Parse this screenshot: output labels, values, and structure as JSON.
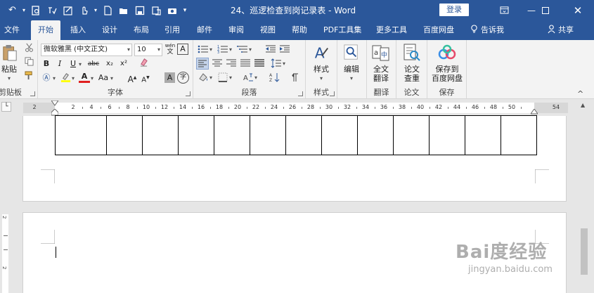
{
  "titlebar": {
    "doc_title": "24、巡逻检查到岗记录表 - Word",
    "login_label": "登录",
    "icons": [
      "undo-icon",
      "redo-icon",
      "print-preview-icon",
      "spelling-icon",
      "markup-icon",
      "touch-mode-icon",
      "new-doc-icon",
      "open-icon",
      "save-icon",
      "save-as-icon",
      "camera-icon",
      "customize-icon"
    ]
  },
  "tabs": [
    {
      "label": "文件"
    },
    {
      "label": "开始"
    },
    {
      "label": "插入"
    },
    {
      "label": "设计"
    },
    {
      "label": "布局"
    },
    {
      "label": "引用"
    },
    {
      "label": "邮件"
    },
    {
      "label": "审阅"
    },
    {
      "label": "视图"
    },
    {
      "label": "帮助"
    },
    {
      "label": "PDF工具集"
    },
    {
      "label": "更多工具"
    },
    {
      "label": "百度网盘"
    },
    {
      "label": "告诉我"
    },
    {
      "label": "共享"
    }
  ],
  "ribbon": {
    "clipboard": {
      "paste_label": "粘贴",
      "group_label": "剪贴板"
    },
    "font": {
      "font_name": "微软雅黑 (中文正文)",
      "font_size": "10",
      "wen_label": "wén",
      "a_box_label": "A",
      "bold": "B",
      "italic": "I",
      "underline": "U",
      "strike": "abc",
      "subscript": "x₂",
      "superscript": "x²",
      "grow": "A",
      "shrink": "A",
      "case": "Aa",
      "char_shade": "A",
      "enclose": "字",
      "group_label": "字体"
    },
    "paragraph": {
      "group_label": "段落"
    },
    "styles": {
      "label": "样式",
      "group_label": "样式"
    },
    "editing": {
      "label": "编辑"
    },
    "translate": {
      "label_line1": "全文",
      "label_line2": "翻译",
      "group_label": "翻译"
    },
    "paper": {
      "label_line1": "论文",
      "label_line2": "查重",
      "group_label": "论文"
    },
    "save": {
      "label_line1": "保存到",
      "label_line2": "百度网盘",
      "group_label": "保存"
    }
  },
  "ruler": {
    "left_label": "2",
    "marks": [
      "2",
      "4",
      "6",
      "8",
      "10",
      "12",
      "14",
      "16",
      "18",
      "20",
      "22",
      "24",
      "26",
      "28",
      "30",
      "32",
      "34",
      "36",
      "38",
      "40",
      "42",
      "44",
      "46",
      "48",
      "50"
    ],
    "right_label": "54"
  },
  "watermark": {
    "logo": "Bai度经验",
    "url": "jingyan.baidu.com"
  }
}
